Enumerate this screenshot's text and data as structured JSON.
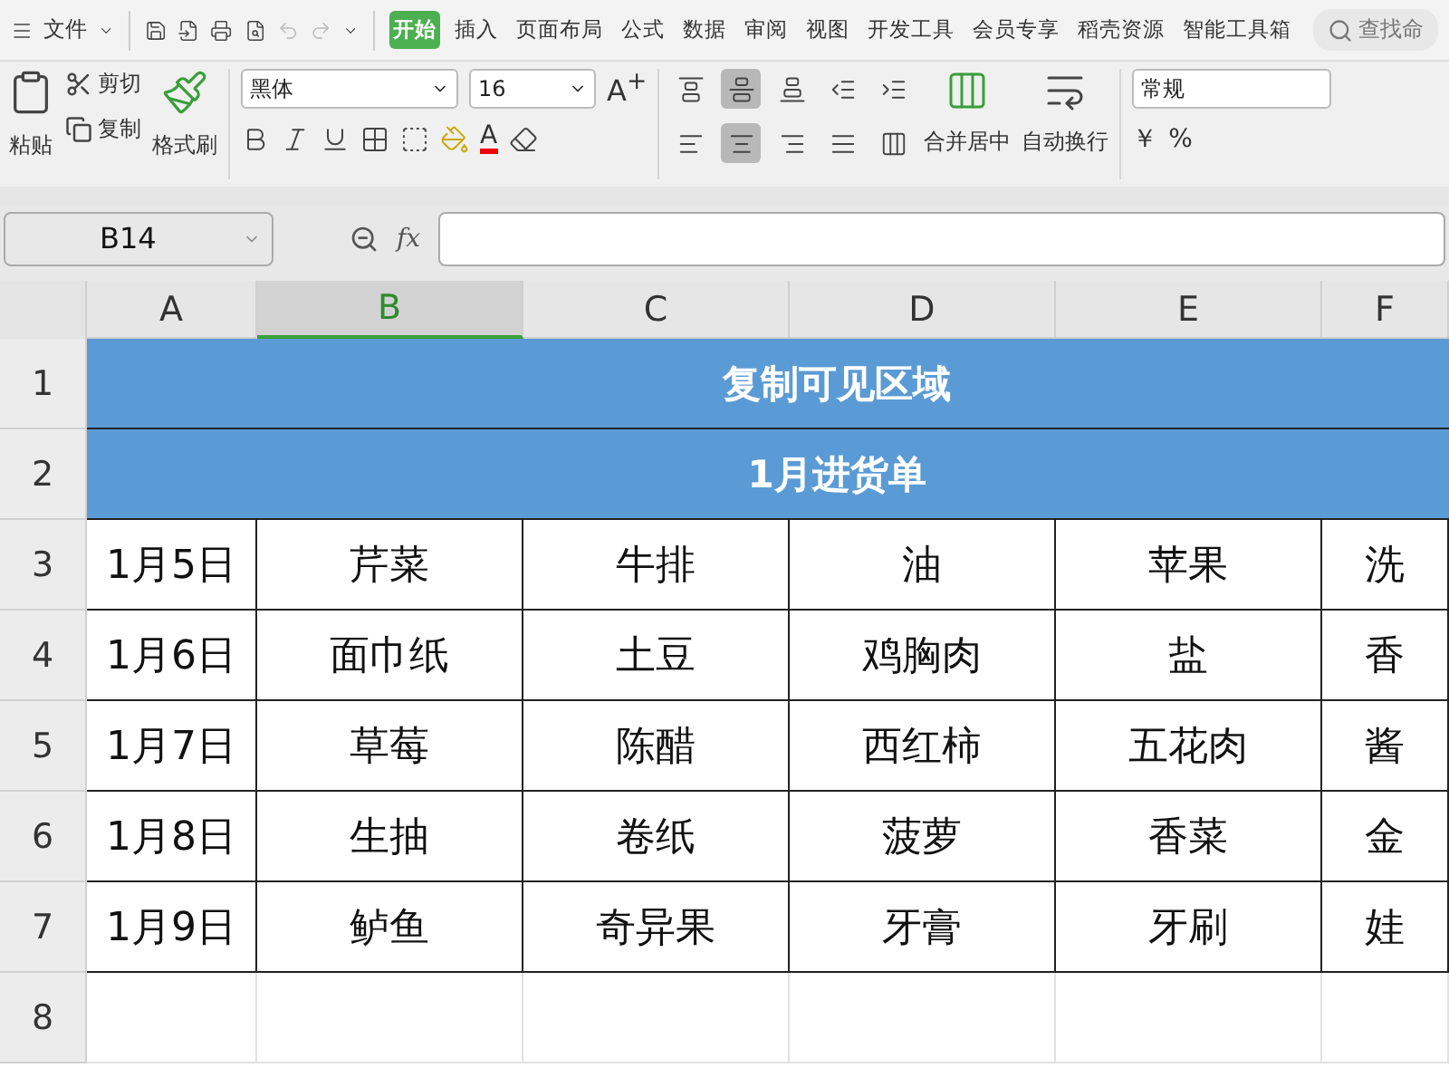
{
  "menu": {
    "file_label": "文件",
    "tabs": [
      {
        "label": "开始",
        "selected": true
      },
      {
        "label": "插入",
        "selected": false
      },
      {
        "label": "页面布局",
        "selected": false
      },
      {
        "label": "公式",
        "selected": false
      },
      {
        "label": "数据",
        "selected": false
      },
      {
        "label": "审阅",
        "selected": false
      },
      {
        "label": "视图",
        "selected": false
      },
      {
        "label": "开发工具",
        "selected": false
      },
      {
        "label": "会员专享",
        "selected": false
      },
      {
        "label": "稻壳资源",
        "selected": false
      },
      {
        "label": "智能工具箱",
        "selected": false
      }
    ],
    "search_placeholder": "查找命"
  },
  "ribbon": {
    "paste": "粘贴",
    "cut": "剪切",
    "copy": "复制",
    "format_painter": "格式刷",
    "font_name": "黑体",
    "font_size": "16",
    "align_buttons": [
      {
        "kind": "top",
        "selected": false
      },
      {
        "kind": "middle",
        "selected": true
      },
      {
        "kind": "bottom",
        "selected": false
      },
      {
        "kind": "outdent",
        "selected": false
      },
      {
        "kind": "indent",
        "selected": false
      },
      {
        "kind": "left",
        "selected": false
      },
      {
        "kind": "center",
        "selected": true
      },
      {
        "kind": "right",
        "selected": false
      },
      {
        "kind": "justify",
        "selected": false
      },
      {
        "kind": "distributed",
        "selected": false
      }
    ],
    "grow_font": "A$^{+}$",
    "font_color": "A",
    "merge": "合并居中",
    "wrap": "自动换行",
    "number_format": "常规",
    "currency": "￥",
    "percent": "%"
  },
  "formula_bar": {
    "cell_ref": "B14",
    "fx_label": "fx"
  },
  "columns": [
    {
      "label": "A",
      "selected": false
    },
    {
      "label": "B",
      "selected": true
    },
    {
      "label": "C",
      "selected": false
    },
    {
      "label": "D",
      "selected": false
    },
    {
      "label": "E",
      "selected": false
    },
    {
      "label": "F",
      "selected": false
    }
  ],
  "rows": [
    {
      "number": "1",
      "kind": "title",
      "text": "复制可见区域"
    },
    {
      "number": "2",
      "kind": "title",
      "text": "1月进货单"
    },
    {
      "number": "3",
      "kind": "data",
      "cells": [
        "1月5日",
        "芹菜",
        "牛排",
        "油",
        "苹果",
        "洗"
      ]
    },
    {
      "number": "4",
      "kind": "data",
      "cells": [
        "1月6日",
        "面巾纸",
        "土豆",
        "鸡胸肉",
        "盐",
        "香"
      ]
    },
    {
      "number": "5",
      "kind": "data",
      "cells": [
        "1月7日",
        "草莓",
        "陈醋",
        "西红柿",
        "五花肉",
        "酱"
      ]
    },
    {
      "number": "6",
      "kind": "data",
      "cells": [
        "1月8日",
        "生抽",
        "卷纸",
        "菠萝",
        "香菜",
        "金"
      ]
    },
    {
      "number": "7",
      "kind": "data",
      "cells": [
        "1月9日",
        "鲈鱼",
        "奇异果",
        "牙膏",
        "牙刷",
        "娃"
      ]
    },
    {
      "number": "8",
      "kind": "empty"
    }
  ]
}
